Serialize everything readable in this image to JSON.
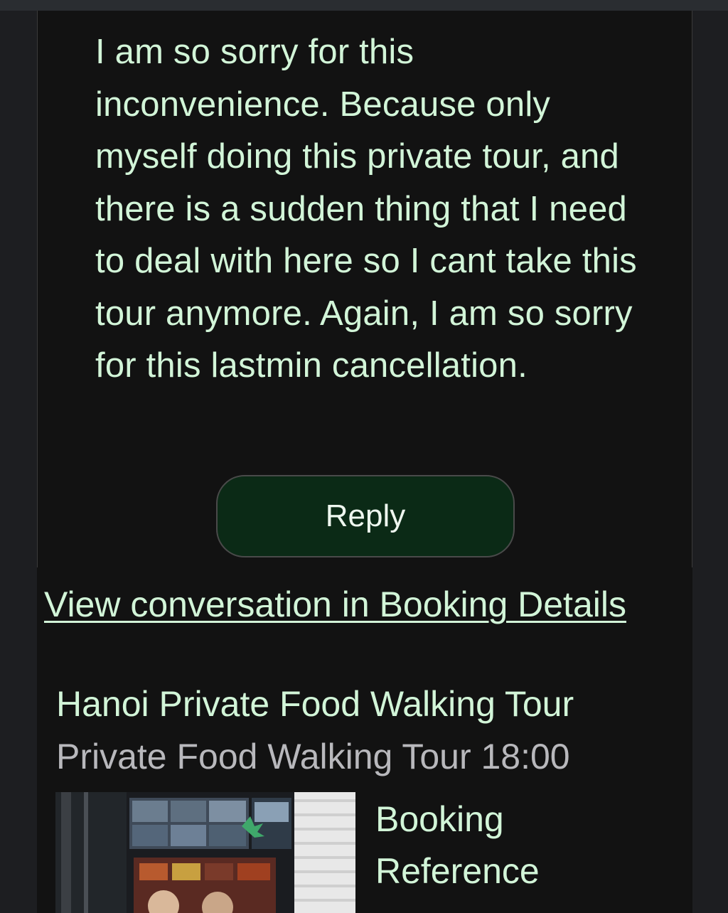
{
  "message": {
    "body": "I am so sorry for this inconvenience. Because only myself doing this private tour, and there is a sudden thing that I need to deal with here so I cant take this tour anymore. Again, I am so sorry for this lastmin cancellation."
  },
  "actions": {
    "reply_label": "Reply",
    "view_conversation_label": "View conversation in Booking Details"
  },
  "booking": {
    "tour_title": "Hanoi Private Food Walking Tour",
    "tour_option": "Private Food Walking Tour 18:00",
    "reference_label": "Booking Reference",
    "photo_icon": "tour-photo"
  },
  "colors": {
    "text_accent": "#d2f5d8",
    "reply_button_bg": "#0b2a16",
    "card_bg": "#121212",
    "page_bg": "#1d1e21",
    "muted_text": "#b8b8bc"
  }
}
